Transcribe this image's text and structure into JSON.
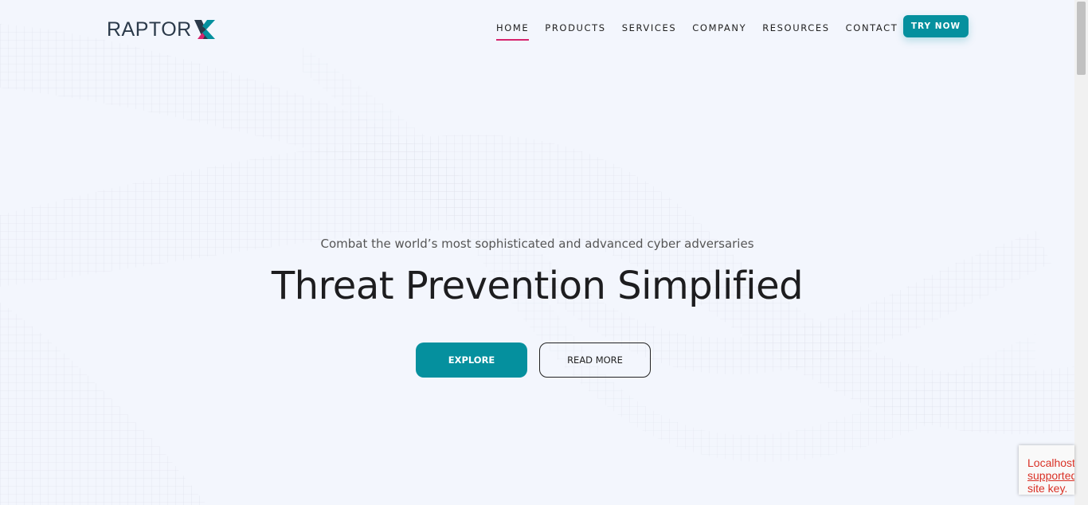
{
  "brand": {
    "name": "RAPTOR",
    "accent_pink": "#d6246e",
    "accent_teal": "#05909e"
  },
  "nav": {
    "items": [
      {
        "label": "HOME",
        "active": true
      },
      {
        "label": "PRODUCTS",
        "active": false
      },
      {
        "label": "SERVICES",
        "active": false
      },
      {
        "label": "COMPANY",
        "active": false
      },
      {
        "label": "RESOURCES",
        "active": false
      },
      {
        "label": "CONTACT",
        "active": false
      }
    ],
    "cta": "TRY NOW"
  },
  "hero": {
    "subtitle": "Combat the world’s most sophisticated and advanced cyber adversaries",
    "title": "Threat Prevention Simplified",
    "primary_button": "EXPLORE",
    "secondary_button": "READ MORE"
  },
  "recaptcha": {
    "line1": "Localhost",
    "line2": "supported",
    "line3": "site key."
  }
}
